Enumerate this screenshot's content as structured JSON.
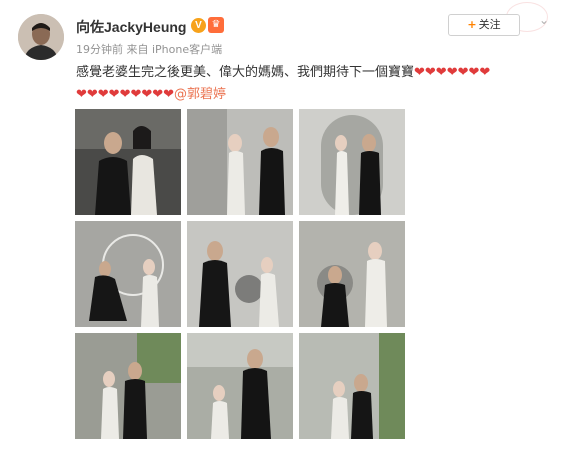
{
  "user": {
    "name": "向佐JackyHeung",
    "verified_badge": "V",
    "member_badge": "♛",
    "avatar_icon": "avatar-photo"
  },
  "meta": {
    "time": "19分钟前",
    "source": "来自 iPhone客户端"
  },
  "follow_button": {
    "plus": "+",
    "label": "关注"
  },
  "more_icon": "⌄",
  "post": {
    "text": "感覺老婆生完之後更美、偉大的媽媽、我們期待下一個寶寶",
    "hearts_line1": "❤❤❤❤❤❤❤",
    "hearts_line2": "❤❤❤❤❤❤❤❤❤",
    "mention": "@郭碧婷"
  },
  "photos": [
    {
      "bg": "#3a3a3a"
    },
    {
      "bg": "#b9b9b6"
    },
    {
      "bg": "#c9c9c4"
    },
    {
      "bg": "#a7a7a2"
    },
    {
      "bg": "#c3c3bf"
    },
    {
      "bg": "#b1b1ab"
    },
    {
      "bg": "#9b9d95"
    },
    {
      "bg": "#a9aca4"
    },
    {
      "bg": "#b6b9b2"
    }
  ],
  "colors": {
    "accent": "#ff8200",
    "heart": "#e03b3b",
    "mention": "#eb7350"
  }
}
